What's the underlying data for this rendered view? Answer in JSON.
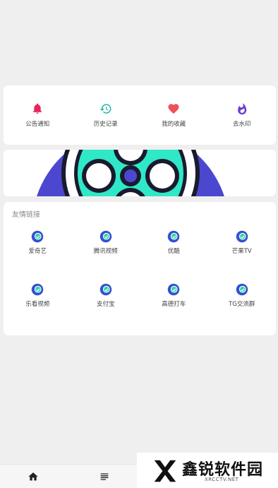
{
  "quick_actions": [
    {
      "label": "公告通知",
      "icon": "bell-icon",
      "color": "#e8245a"
    },
    {
      "label": "历史记录",
      "icon": "history-icon",
      "color": "#20b7a8"
    },
    {
      "label": "我的收藏",
      "icon": "heart-icon",
      "color": "#ef5156"
    },
    {
      "label": "去水印",
      "icon": "flame-icon",
      "color": "#6a3ad8"
    }
  ],
  "banner": {
    "colors": {
      "accent": "#4b48cf",
      "reel": "#2fe8c7",
      "ink": "#1a1a2e"
    }
  },
  "links": {
    "title": "友情链接",
    "items": [
      {
        "label": "爱奇艺",
        "icon": "app-link-icon"
      },
      {
        "label": "腾讯视频",
        "icon": "app-link-icon"
      },
      {
        "label": "优酷",
        "icon": "app-link-icon"
      },
      {
        "label": "芒果TV",
        "icon": "app-link-icon"
      },
      {
        "label": "乐看视频",
        "icon": "app-link-icon"
      },
      {
        "label": "支付宝",
        "icon": "app-link-icon"
      },
      {
        "label": "高德打车",
        "icon": "app-link-icon"
      },
      {
        "label": "TG交流群",
        "icon": "app-link-icon"
      }
    ]
  },
  "bottom_nav": [
    {
      "icon": "home-icon"
    },
    {
      "icon": "list-icon"
    }
  ],
  "watermark": {
    "title": "鑫锐软件园",
    "subtitle": "XRCCTV.NET"
  }
}
